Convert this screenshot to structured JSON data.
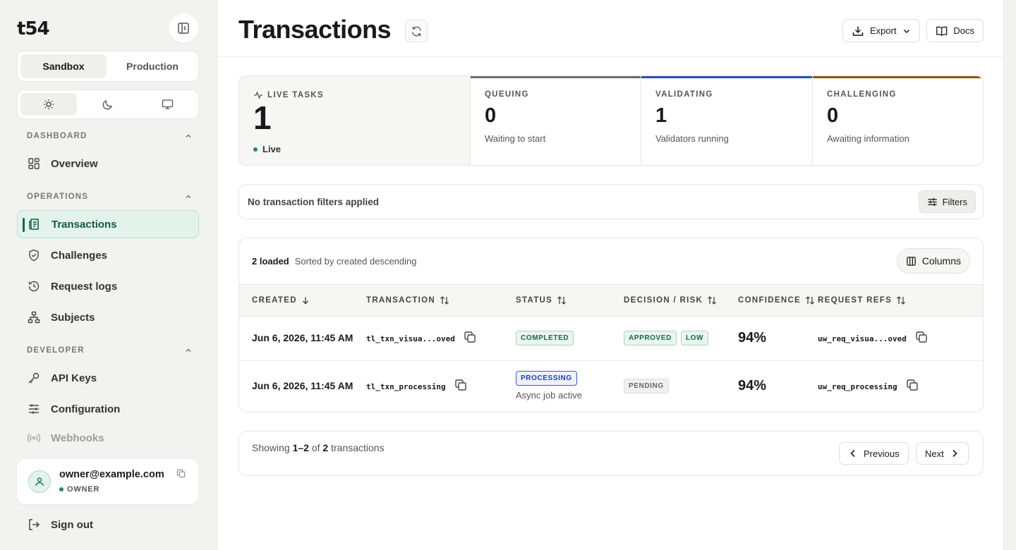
{
  "brand": {
    "logo_text": "t54"
  },
  "environment": {
    "options": [
      "Sandbox",
      "Production"
    ],
    "active": "Sandbox"
  },
  "theme": {
    "options": [
      "light",
      "dark",
      "system"
    ],
    "active": "light"
  },
  "sidebar": {
    "sections": [
      {
        "title": "DASHBOARD",
        "items": [
          {
            "label": "Overview",
            "icon": "grid-icon"
          }
        ]
      },
      {
        "title": "OPERATIONS",
        "items": [
          {
            "label": "Transactions",
            "icon": "receipt-icon",
            "active": true
          },
          {
            "label": "Challenges",
            "icon": "shield-icon"
          },
          {
            "label": "Request logs",
            "icon": "history-icon"
          },
          {
            "label": "Subjects",
            "icon": "hierarchy-icon"
          }
        ]
      },
      {
        "title": "DEVELOPER",
        "items": [
          {
            "label": "API Keys",
            "icon": "key-icon"
          },
          {
            "label": "Configuration",
            "icon": "sliders-icon"
          },
          {
            "label": "Webhooks",
            "icon": "broadcast-icon"
          }
        ]
      }
    ]
  },
  "user": {
    "email": "owner@example.com",
    "role": "OWNER"
  },
  "signout_label": "Sign out",
  "header": {
    "title": "Transactions",
    "export_label": "Export",
    "docs_label": "Docs"
  },
  "stats": {
    "live": {
      "label": "LIVE TASKS",
      "value": "1",
      "status": "Live"
    },
    "queuing": {
      "label": "QUEUING",
      "value": "0",
      "sub": "Waiting to start",
      "color": "#6b6f76"
    },
    "validating": {
      "label": "VALIDATING",
      "value": "1",
      "sub": "Validators running",
      "color": "#2a4cc4"
    },
    "challenging": {
      "label": "CHALLENGING",
      "value": "0",
      "sub": "Awaiting information",
      "color": "#8a5a0a"
    }
  },
  "filters": {
    "status_text": "No transaction filters applied",
    "button_label": "Filters"
  },
  "table": {
    "loaded_text": "2 loaded",
    "sort_text": "Sorted by created descending",
    "columns_label": "Columns",
    "headers": [
      "CREATED",
      "TRANSACTION",
      "STATUS",
      "DECISION / RISK",
      "CONFIDENCE",
      "REQUEST REFS"
    ],
    "rows": [
      {
        "created": "Jun 6, 2026, 11:45 AM",
        "transaction": "tl_txn_visua...oved",
        "status": "COMPLETED",
        "decision": "APPROVED",
        "risk": "LOW",
        "confidence": "94%",
        "request_ref": "uw_req_visua...oved"
      },
      {
        "created": "Jun 6, 2026, 11:45 AM",
        "transaction": "tl_txn_processing",
        "status": "PROCESSING",
        "status_note": "Async job active",
        "decision": "PENDING",
        "confidence": "94%",
        "request_ref": "uw_req_processing"
      }
    ]
  },
  "pagination": {
    "prefix": "Showing",
    "range": "1–2",
    "of": "of",
    "total": "2",
    "suffix": "transactions",
    "prev_label": "Previous",
    "next_label": "Next"
  }
}
